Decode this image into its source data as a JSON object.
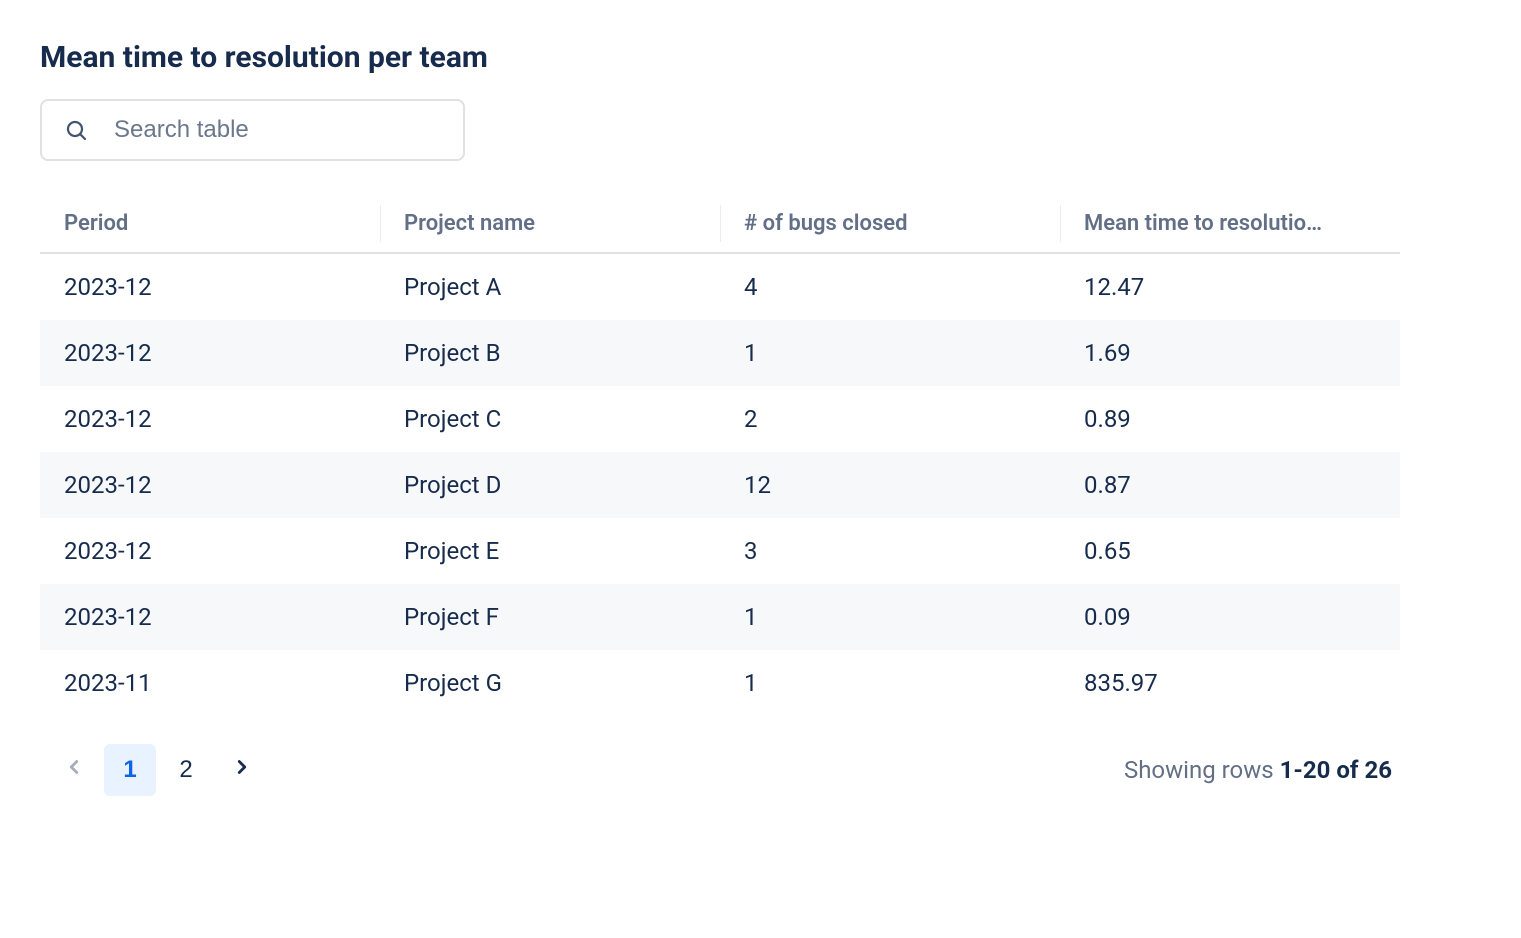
{
  "title": "Mean time to resolution per team",
  "search": {
    "placeholder": "Search table",
    "value": ""
  },
  "table": {
    "columns": [
      "Period",
      "Project name",
      "# of bugs closed",
      "Mean time to resolutio…"
    ],
    "rows": [
      {
        "period": "2023-12",
        "project": "Project A",
        "bugs": "4",
        "mttr": "12.47"
      },
      {
        "period": "2023-12",
        "project": "Project B",
        "bugs": "1",
        "mttr": "1.69"
      },
      {
        "period": "2023-12",
        "project": "Project C",
        "bugs": "2",
        "mttr": "0.89"
      },
      {
        "period": "2023-12",
        "project": "Project D",
        "bugs": "12",
        "mttr": "0.87"
      },
      {
        "period": "2023-12",
        "project": "Project E",
        "bugs": "3",
        "mttr": "0.65"
      },
      {
        "period": "2023-12",
        "project": "Project F",
        "bugs": "1",
        "mttr": "0.09"
      },
      {
        "period": "2023-11",
        "project": "Project G",
        "bugs": "1",
        "mttr": "835.97"
      }
    ]
  },
  "pagination": {
    "pages": [
      "1",
      "2"
    ],
    "active": "1",
    "summary_prefix": "Showing rows ",
    "range": "1-20",
    "of": " of ",
    "total": "26"
  }
}
